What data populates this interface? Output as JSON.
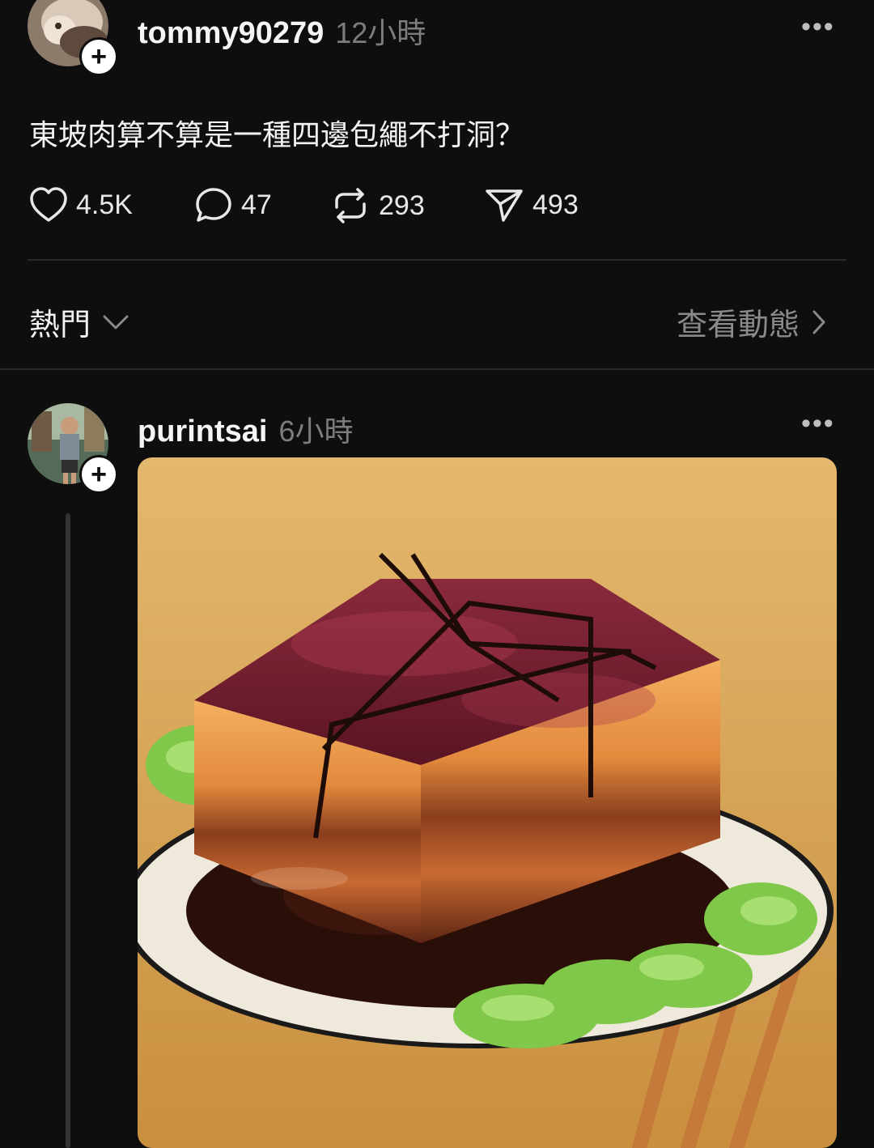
{
  "post1": {
    "username": "tommy90279",
    "time": "12小時",
    "text": "東坡肉算不算是一種四邊包繩不打洞？",
    "actions": {
      "likes": "4.5K",
      "comments": "47",
      "reposts": "293",
      "shares": "493"
    },
    "avatar_icon": "avatar-dog-photo",
    "follow_icon": "plus-icon"
  },
  "feed_header": {
    "sort_label": "熱門",
    "view_activity_label": "查看動態"
  },
  "post2": {
    "username": "purintsai",
    "time": "6小時",
    "avatar_icon": "avatar-person-photo",
    "follow_icon": "plus-icon",
    "image_icon": "dongpo-pork-photo"
  },
  "colors": {
    "background": "#0e0e0e",
    "text": "#f3f3f3",
    "muted": "#7d7d7d",
    "divider": "#2a2a2a"
  }
}
